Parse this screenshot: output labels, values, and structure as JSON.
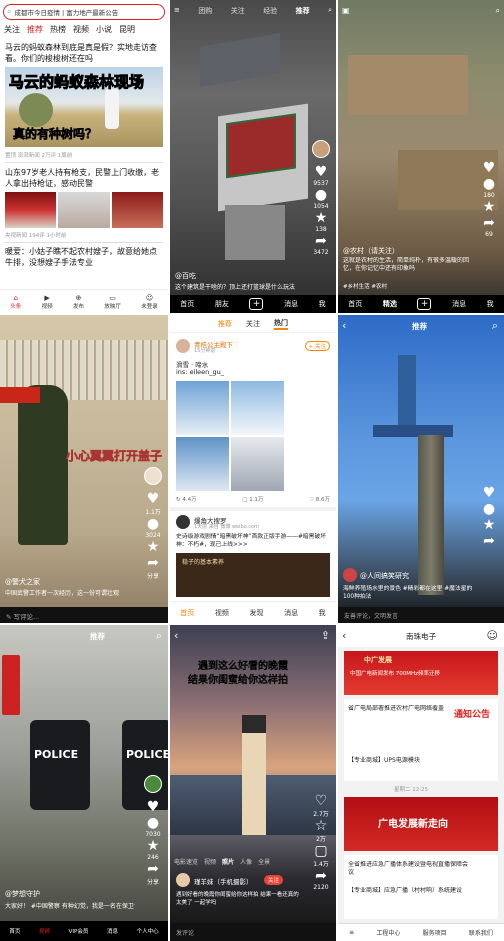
{
  "p1": {
    "search": "成都市今日疫情 | 富力地产最新公告",
    "tabs": [
      "关注",
      "推荐",
      "热榜",
      "视频",
      "小说",
      "昆明"
    ],
    "news": [
      {
        "title": "马云的蚂蚁森林到底是真是假？实地走访查看。你们的梭梭树还在吗",
        "img_title": "马云的蚂蚁森林现场",
        "img_sub": "真的有种树吗？",
        "meta": "置顶  澎湃新闻 2万评 1周前"
      },
      {
        "title": "山东97岁老人持有枪支，民警上门收缴，老人拿出持枪证，感动民警",
        "meta": "央视新闻  194评  1小时前"
      },
      {
        "title": "暖爱：小姑子瞧不起农村嫂子，故意给她点牛排，没想嫂子手法专业",
        "meta": ""
      }
    ],
    "nav": [
      "头条",
      "视频",
      "发布",
      "放映厅",
      "未登录"
    ]
  },
  "p2": {
    "tabs": [
      "团购",
      "关注",
      "经验",
      "推荐"
    ],
    "badge": "新",
    "caption": "@百吃",
    "desc": "这个建筑是干啥的？顶上还打篮球是什么玩法",
    "side": [
      "9537",
      "1054",
      "138",
      "3472"
    ],
    "nav": [
      "首页",
      "朋友",
      "消息",
      "我"
    ]
  },
  "p3": {
    "caption": "@农村（请关注）",
    "desc": "这就是农村的生活，简单纯朴，有很多温暖的回忆，在你记忆中还有印象吗",
    "sub": "#乡村生活 #农村",
    "side": [
      "",
      "180",
      "",
      "69"
    ],
    "nav": [
      "首页",
      "精选",
      "消息",
      "我"
    ]
  },
  "p4": {
    "overlay": "小心翼翼打开盖子",
    "caption": "@警犬之家",
    "desc": "中国武警工作者一次经历，这一份可谓壮观",
    "bottom": "写评论...",
    "side": [
      "1.1万",
      "3024",
      "",
      "分享"
    ]
  },
  "p5": {
    "tabs": [
      "推荐",
      "关注",
      "热门"
    ],
    "post1": {
      "user": "青桔公主殿下",
      "meta": "15分钟前",
      "text": "滑雪 · 啼水",
      "text2": "ins: eileen_gu_",
      "likes": "4.4万",
      "comments": "1.1万",
      "shares": "8.6万",
      "follow": "+ 关注"
    },
    "post2": {
      "user": "爆角大搜罗",
      "meta": "1天前 来自 微博 weibo.com",
      "text": "史诗级游戏剧情“暗黑破坏神”首款正版手游——#暗黑破坏神：不朽#，现已上线>>>",
      "card": "稳子的基本素养"
    },
    "nav": [
      "首页",
      "视频",
      "发现",
      "消息",
      "我"
    ]
  },
  "p6": {
    "tab": "推荐",
    "caption": "@人间搞笑研究",
    "desc": "海鲜养殖场水里的景色 #精彩都在这里 #魔法星的100种拍法",
    "bottom": "友善评论，文明发言",
    "side": [
      "",
      "",
      "",
      ""
    ]
  },
  "p7": {
    "label": "POLICE",
    "caption": "@梦想守护",
    "desc": "大家好！ #中国警察 有种幻觉，我是一名在保卫世界安全的",
    "side": [
      "",
      "7030",
      "246",
      "分享"
    ],
    "nav": [
      "首页",
      "视频",
      "VIP会员",
      "消息",
      "个人中心"
    ],
    "top": "推荐"
  },
  "p8": {
    "overlay1": "遇到这么好看的晚霞",
    "overlay2": "结果你闺蜜给你这样拍",
    "tabs": [
      "电影速览",
      "视频",
      "照片",
      "人像",
      "全景"
    ],
    "user": "瑾羊妹（手机摄影）",
    "follow": "关注",
    "desc": "遇到好看的晚霞你闺蜜给你这样拍 结果一看还真的太美了 一起学吗",
    "bottom": "发评论",
    "side": [
      "2.7万",
      "2万",
      "1.4万",
      "2120"
    ]
  },
  "p9": {
    "title": "南珠电子",
    "banner1": "中广发展",
    "banner1_sub": "中国广电新闻发布 700MHz频率迁移",
    "banner2": "广电发展新走向",
    "news": [
      "省广电局部署推进农村广电网络覆盖",
      "【专业商城】UPS电源模块"
    ],
    "notice": "通知公告",
    "divider": "星期二 12:25",
    "news2": [
      "全省推进应急广播体系建设暨电视直播保障会议",
      "【专业商城】应急广播（村村响）系统建设"
    ],
    "nav": [
      "工程中心",
      "服务项目",
      "联系我们"
    ]
  }
}
